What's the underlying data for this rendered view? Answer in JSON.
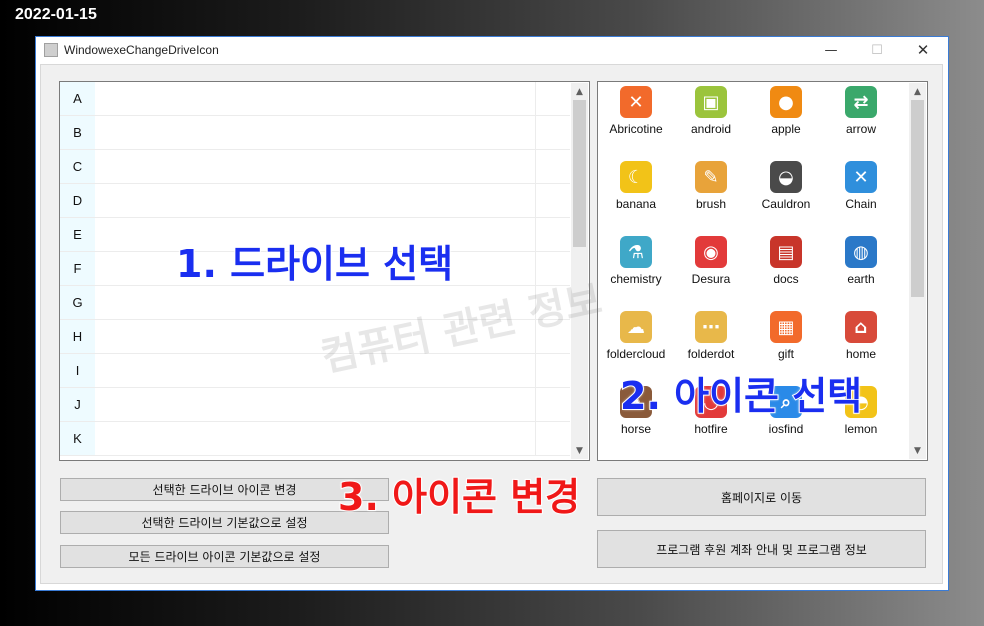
{
  "date_stamp": "2022-01-15",
  "window": {
    "title": "WindowexeChangeDriveIcon",
    "minimize_glyph": "—",
    "maximize_glyph": "☐",
    "close_glyph": "✕"
  },
  "drives": [
    "A",
    "B",
    "C",
    "D",
    "E",
    "F",
    "G",
    "H",
    "I",
    "J",
    "K"
  ],
  "icons": [
    {
      "label": "Abricotine",
      "icon": "abricotine-icon",
      "color": "#f26a2b",
      "glyph": "✕"
    },
    {
      "label": "android",
      "icon": "android-icon",
      "color": "#9bc43c",
      "glyph": "▣"
    },
    {
      "label": "apple",
      "icon": "apple-icon",
      "color": "#f08a12",
      "glyph": "●"
    },
    {
      "label": "arrow",
      "icon": "arrow-icon",
      "color": "#3aa86b",
      "glyph": "⇄"
    },
    {
      "label": "banana",
      "icon": "banana-icon",
      "color": "#f2c318",
      "glyph": "☾"
    },
    {
      "label": "brush",
      "icon": "brush-icon",
      "color": "#e8a33a",
      "glyph": "✎"
    },
    {
      "label": "Cauldron",
      "icon": "cauldron-icon",
      "color": "#4a4a4a",
      "glyph": "◒"
    },
    {
      "label": "Chain",
      "icon": "chain-icon",
      "color": "#2f8fdc",
      "glyph": "✕"
    },
    {
      "label": "chemistry",
      "icon": "chemistry-icon",
      "color": "#3fa8c8",
      "glyph": "⚗"
    },
    {
      "label": "Desura",
      "icon": "desura-icon",
      "color": "#e23a3a",
      "glyph": "◉"
    },
    {
      "label": "docs",
      "icon": "docs-icon",
      "color": "#c8352a",
      "glyph": "▤"
    },
    {
      "label": "earth",
      "icon": "earth-icon",
      "color": "#2a78c8",
      "glyph": "◍"
    },
    {
      "label": "foldercloud",
      "icon": "folder-cloud-icon",
      "color": "#e8b84a",
      "glyph": "☁"
    },
    {
      "label": "folderdot",
      "icon": "folder-dot-icon",
      "color": "#e8b84a",
      "glyph": "⋯"
    },
    {
      "label": "gift",
      "icon": "gift-icon",
      "color": "#f26a2b",
      "glyph": "▦"
    },
    {
      "label": "home",
      "icon": "home-icon",
      "color": "#d84a3a",
      "glyph": "⌂"
    },
    {
      "label": "horse",
      "icon": "horse-icon",
      "color": "#8a5a3a",
      "glyph": "♞"
    },
    {
      "label": "hotfire",
      "icon": "hotfire-icon",
      "color": "#e23a3a",
      "glyph": "◡"
    },
    {
      "label": "iosfind",
      "icon": "ios-find-icon",
      "color": "#2a8ae8",
      "glyph": "⌕"
    },
    {
      "label": "lemon",
      "icon": "lemon-icon",
      "color": "#f2c318",
      "glyph": "◓"
    }
  ],
  "buttons": {
    "change_selected": "선택한 드라이브 아이콘 변경",
    "reset_selected": "선택한 드라이브 기본값으로 설정",
    "reset_all": "모든 드라이브 아이콘 기본값으로 설정",
    "homepage": "홈페이지로 이동",
    "support_info": "프로그램 후원 계좌 안내 및 프로그램 정보"
  },
  "annotations": {
    "step1": "1. 드라이브 선택",
    "step2": "2. 아이콘 선택",
    "step3": "3. 아이콘 변경",
    "watermark": "컴퓨터 관련 정보"
  },
  "colors": {
    "annotation_blue": "#1a2ef0",
    "annotation_red": "#f01818",
    "drive_letter_bg": "#eefbff",
    "window_border": "#3a7bd5"
  }
}
